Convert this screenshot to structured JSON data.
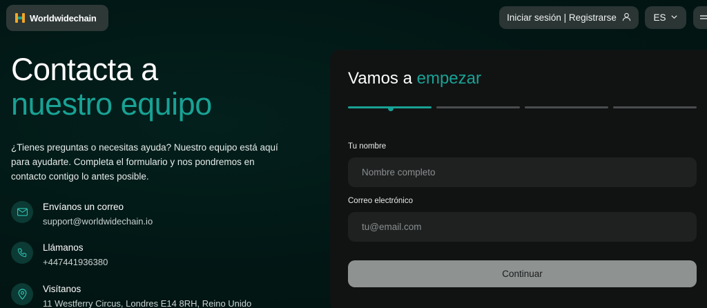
{
  "header": {
    "brand": "Worldwidechain",
    "login_label": "Iniciar sesión | Registrarse",
    "language": "ES"
  },
  "hero": {
    "title_line1": "Contacta a",
    "title_line2": "nuestro equipo",
    "description": "¿Tienes preguntas o necesitas ayuda? Nuestro equipo está aquí para ayudarte. Completa el formulario y nos pondremos en contacto contigo lo antes posible."
  },
  "contacts": [
    {
      "icon": "mail-icon",
      "title": "Envíanos un correo",
      "value": "support@worldwidechain.io"
    },
    {
      "icon": "phone-icon",
      "title": "Llámanos",
      "value": "+447441936380"
    },
    {
      "icon": "location-pin-icon",
      "title": "Visítanos",
      "value": "11 Westferry Circus, Londres E14 8RH, Reino Unido"
    }
  ],
  "form": {
    "title_plain": "Vamos a",
    "title_accent": "empezar",
    "steps_total": 4,
    "current_step": 1,
    "name_label": "Tu nombre",
    "name_placeholder": "Nombre completo",
    "email_label": "Correo electrónico",
    "email_placeholder": "tu@email.com",
    "submit_label": "Continuar"
  },
  "colors": {
    "accent": "#18a295",
    "background": "#021714",
    "card": "#111313",
    "button_disabled": "#8e9291"
  }
}
